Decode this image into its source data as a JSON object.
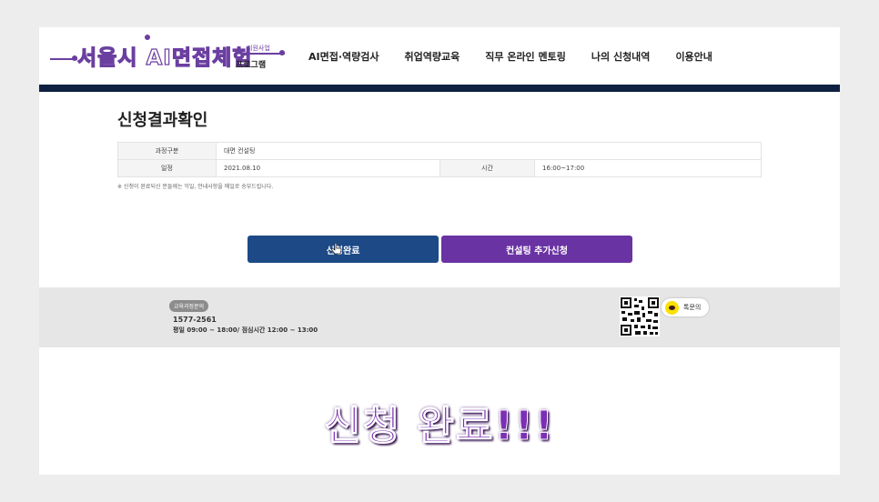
{
  "header": {
    "logo_text": "서울시 AI면접체험",
    "logo_sub": "지원사업",
    "logo_program": "프로그램",
    "nav": [
      {
        "label": "AI면접·역량검사"
      },
      {
        "label": "취업역량교육"
      },
      {
        "label": "직무 온라인 멘토링"
      },
      {
        "label": "나의 신청내역"
      },
      {
        "label": "이용안내"
      }
    ]
  },
  "main": {
    "title": "신청결과확인",
    "table": {
      "row1": {
        "label": "과정구분",
        "value": "대면 컨설팅"
      },
      "row2": {
        "label": "일정",
        "value": "2021.08.10",
        "label2": "시간",
        "value2": "16:00~17:00"
      }
    },
    "notice": "※ 신청이 완료되신 분들께는 익일, 안내사항을 메일로 송부드립니다.",
    "buttons": {
      "complete": "신청완료",
      "add": "컨설팅 추가신청"
    }
  },
  "footer": {
    "badge": "교육과정문의",
    "phone": "1577-2561",
    "hours": "평일 09:00 ~ 18:00/ 점심시간 12:00 ~ 13:00",
    "talk_label": "톡문의"
  },
  "caption": "신청 완료!!!",
  "colors": {
    "nav_bar": "#0e2140",
    "btn_complete": "#1d4a86",
    "btn_add": "#6a33a3",
    "caption": "#7b2fb5"
  }
}
